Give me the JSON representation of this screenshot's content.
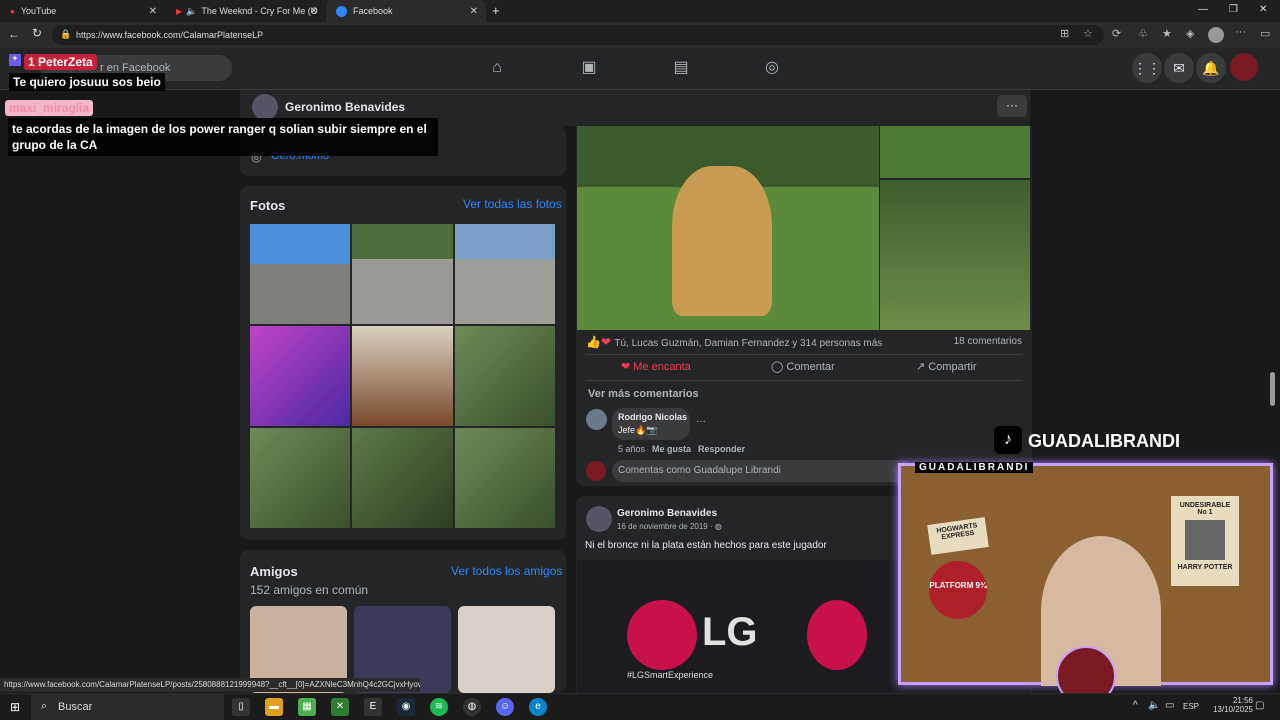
{
  "browser": {
    "tabs": [
      {
        "label": "YouTube"
      },
      {
        "label": "The Weeknd - Cry For Me (O"
      },
      {
        "label": "Facebook"
      }
    ],
    "url": "https://www.facebook.com/CalamarPlatenseLP",
    "status_url": "https://www.facebook.com/CalamarPlatenseLP/posts/258088812199994​8?__cft__[0]=AZXNleC3MnhQ4c2GCjvxHyov..."
  },
  "fb": {
    "search_placeholder": "r en Facebook",
    "profile_name": "Geronimo Benavides",
    "instagram": "Gero.momo",
    "photos": {
      "title": "Fotos",
      "link": "Ver todas las fotos"
    },
    "friends": {
      "title": "Amigos",
      "count": "152 amigos en común",
      "link": "Ver todos los amigos"
    },
    "post1": {
      "reactions": "Tú, Lucas Guzmán, Damian Fernandez y 314 personas más",
      "comments_count": "18 comentarios",
      "like_label": "Me encanta",
      "comment_label": "Comentar",
      "share_label": "Compartir",
      "more_comments": "Ver más comentarios",
      "comment": {
        "author": "Rodrigo Nicolas",
        "text": "Jefe🔥📷",
        "age": "5 años",
        "like": "Me gusta",
        "reply": "Responder"
      },
      "comment_as": "Comentas como Guadalupe Librandi"
    },
    "post2": {
      "author": "Geronimo Benavides",
      "date": "16 de noviembre de 2019 · ",
      "text": "Ni el bronce ni la plata están hechos para este jugador",
      "brand": "LG",
      "tagline": "#LGSmartExperience"
    }
  },
  "stream": {
    "chat": [
      {
        "name": "PeterZeta",
        "badge": "1",
        "msg": "Te quiero josuuu sos beio"
      },
      {
        "name": "maxi_miraglia",
        "msg": "te acordas de la imagen de los power ranger q solian subir siempre en el grupo de la CA"
      }
    ],
    "tiktok_handle": "GUADALIBRANDI",
    "cam_label": "GUADALIBRANDI",
    "poster1": "HOGWARTS EXPRESS",
    "poster2": "PLATFORM 9¾",
    "poster3": "UNDESIRABLE No 1",
    "poster4": "HARRY POTTER"
  },
  "taskbar": {
    "search": "Buscar",
    "lang": "ESP",
    "time": "21:56",
    "date": "13/10/2025"
  },
  "colors": {
    "fb_blue": "#2d88ff",
    "love": "#f33e58",
    "bg": "#18191a",
    "card": "#242526"
  }
}
